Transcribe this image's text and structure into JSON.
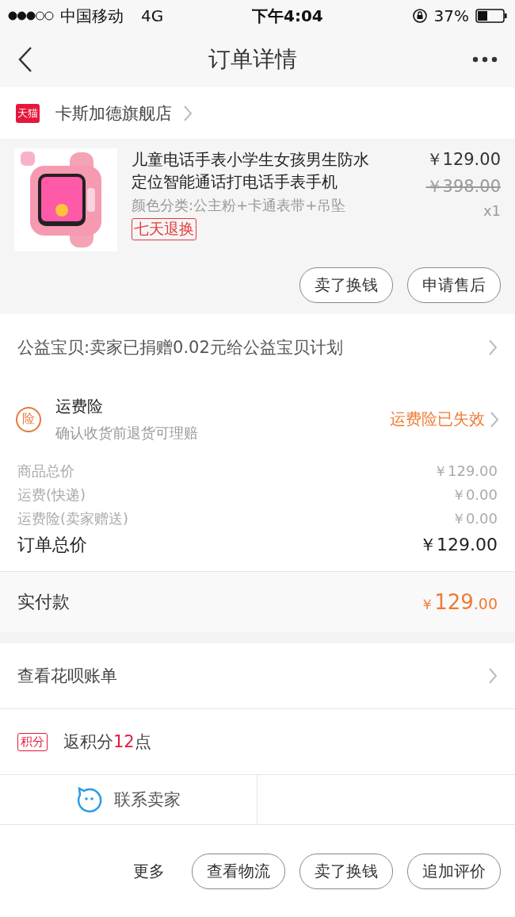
{
  "status_bar": {
    "carrier": "中国移动",
    "network": "4G",
    "time": "下午4:04",
    "battery": "37%"
  },
  "nav": {
    "title": "订单详情"
  },
  "shop": {
    "badge": "天猫",
    "name": "卡斯加德旗舰店"
  },
  "product": {
    "title": "儿童电话手表小学生女孩男生防水定位智能通话打电话手表手机",
    "variant": "颜色分类:公主粉+卡通表带+吊坠",
    "tag": "七天退换",
    "price": "￥129.00",
    "original_price": "￥398.00",
    "quantity": "x1",
    "actions": [
      "卖了换钱",
      "申请售后"
    ]
  },
  "charity": {
    "text": "公益宝贝:卖家已捐赠0.02元给公益宝贝计划"
  },
  "insurance": {
    "icon": "险",
    "title": "运费险",
    "subtitle": "确认收货前退货可理赔",
    "status": "运费险已失效"
  },
  "price_lines": [
    {
      "label": "商品总价",
      "value": "￥129.00",
      "kind": "minor"
    },
    {
      "label": "运费(快递)",
      "value": "￥0.00",
      "kind": "minor"
    },
    {
      "label": "运费险(卖家赠送)",
      "value": "￥0.00",
      "kind": "minor"
    },
    {
      "label": "订单总价",
      "value": "￥129.00",
      "kind": "total"
    }
  ],
  "paid": {
    "label": "实付款",
    "currency": "￥",
    "integer": "129",
    "decimal": ".00"
  },
  "huabei": {
    "text": "查看花呗账单"
  },
  "points": {
    "badge": "积分",
    "prefix": "返积分",
    "amount": "12",
    "suffix": "点"
  },
  "contact": {
    "label": "联系卖家"
  },
  "bottom_bar": {
    "more": "更多",
    "buttons": [
      "查看物流",
      "卖了换钱",
      "追加评价"
    ]
  }
}
